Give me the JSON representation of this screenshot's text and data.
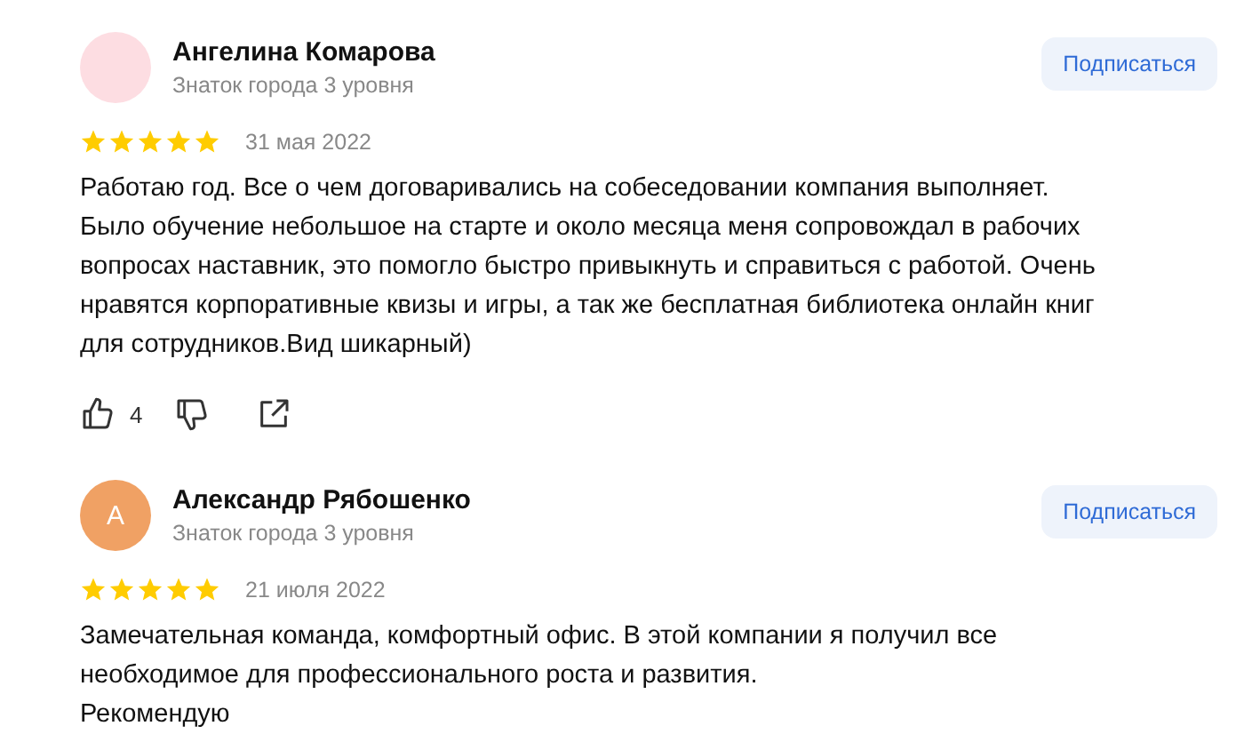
{
  "reviews": [
    {
      "author": "Ангелина Комарова",
      "avatar": {
        "color": "#fddde2"
      },
      "level": "Знаток города 3 уровня",
      "subscribe": "Подписаться",
      "stars": 5,
      "date": "31 мая 2022",
      "text": "Работаю год. Все о чем договаривались на собеседовании компания выполняет.\nБыло обучение небольшое на старте и около месяца меня сопровождал в рабочих\nвопросах наставник, это помогло быстро привыкнуть и справиться с работой. Очень\nнравятся корпоративные квизы и игры, а так же бесплатная библиотека онлайн книг\nдля сотрудников.Вид шикарный)",
      "likes": "4"
    },
    {
      "author": "Александр Рябошенко",
      "avatar": {
        "letter": "А",
        "color": "#f0a164"
      },
      "level": "Знаток города 3 уровня",
      "subscribe": "Подписаться",
      "stars": 5,
      "date": "21 июля 2022",
      "text": "Замечательная команда, комфортный офис. В этой компании я получил все\nнеобходимое для профессионального роста и развития.\nРекомендую"
    }
  ]
}
